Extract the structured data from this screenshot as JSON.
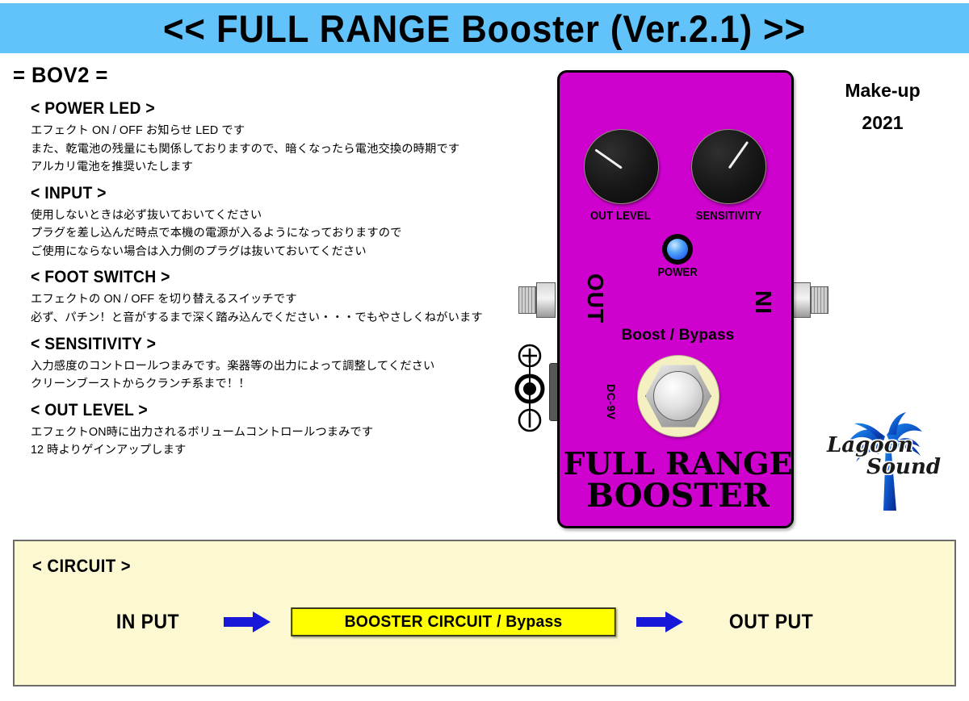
{
  "banner": {
    "title": "<< FULL RANGE Booster (Ver.2.1) >>",
    "background_color": "#62c2fa"
  },
  "model_name": "= BOV2 =",
  "makeup": {
    "line1": "Make-up",
    "line2": "2021"
  },
  "sections": [
    {
      "heading": "< POWER LED >",
      "lines": [
        "エフェクト ON / OFF お知らせ LED です",
        "また、乾電池の残量にも関係しておりますので、暗くなったら電池交換の時期です",
        "アルカリ電池を推奨いたします"
      ]
    },
    {
      "heading": "< INPUT >",
      "lines": [
        "使用しないときは必ず抜いておいてください",
        "プラグを差し込んだ時点で本機の電源が入るようになっておりますので",
        "ご使用にならない場合は入力側のプラグは抜いておいてください"
      ]
    },
    {
      "heading": "< FOOT SWITCH >",
      "lines": [
        "エフェクトの ON / OFF を切り替えるスイッチです",
        "必ず、パチン！と音がするまで深く踏み込んでください・・・でもやさしくねがいます"
      ]
    },
    {
      "heading": "< SENSITIVITY >",
      "lines": [
        "入力感度のコントロールつまみです。楽器等の出力によって調整してください",
        "クリーンブーストからクランチ系まで！！"
      ]
    },
    {
      "heading": "< OUT LEVEL >",
      "lines": [
        "エフェクトON時に出力されるボリュームコントロールつまみです",
        "12 時よりゲインアップします"
      ]
    }
  ],
  "pedal": {
    "body_color": "#cf01cf",
    "knobs": [
      {
        "label": "OUT LEVEL",
        "pointer_angle_deg": 215
      },
      {
        "label": "SENSITIVITY",
        "pointer_angle_deg": -55
      }
    ],
    "led_label": "POWER",
    "led_color": "#0b3df0",
    "jack_out_label": "OUT",
    "jack_in_label": "IN",
    "dc_label": "DC-9V",
    "footswitch_label": "Boost / Bypass",
    "brand_line1": "FULL RANGE",
    "brand_line2": "BOOSTER"
  },
  "logo": {
    "line1": "Lagoon",
    "line2": "Sound",
    "palm_color": "#0a55c8"
  },
  "circuit": {
    "heading": "< CIRCUIT >",
    "input_label": "IN PUT",
    "box_label": "BOOSTER CIRCUIT  / Bypass",
    "output_label": "OUT PUT",
    "box_color": "#ffff00",
    "arrow_color": "#1818d8",
    "panel_color": "#fbf8d2"
  }
}
